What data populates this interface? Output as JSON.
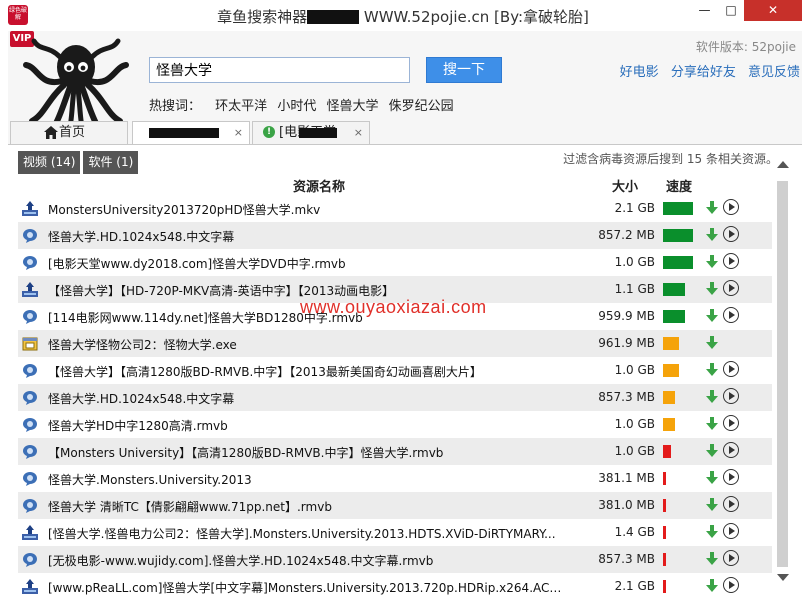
{
  "window": {
    "title_prefix": "章鱼搜索神器",
    "title_suffix": " WWW.52pojie.cn [By:拿破轮胎]",
    "icon_text": "绿色破解",
    "minimize": "—",
    "maximize": "□",
    "close": "✕"
  },
  "header": {
    "vip": "VIP",
    "search_value": "怪兽大学",
    "search_button": "搜一下",
    "hot_label": "热搜词：",
    "hot_words": [
      "环太平洋",
      "小时代",
      "怪兽大学",
      "侏罗纪公园"
    ],
    "version": "软件版本: 52pojie",
    "links": [
      "好电影",
      "分享给好友",
      "意见反馈"
    ]
  },
  "tabs": [
    {
      "label": "首页"
    },
    {
      "label": "",
      "close": "×"
    },
    {
      "label": "[电影天堂",
      "close": "×"
    }
  ],
  "filters": [
    {
      "label": "视频 (14)"
    },
    {
      "label": "软件 (1)"
    }
  ],
  "summary": "过滤含病毒资源后搜到 15 条相关资源。",
  "columns": {
    "name": "资源名称",
    "size": "大小",
    "speed": "速度"
  },
  "watermark": "www.ouyaoxiazai.com",
  "colors": {
    "speed_green": "#0a8f2c",
    "speed_orange": "#f5a30a",
    "speed_red": "#e31b1b",
    "link": "#2a6ebb"
  },
  "rows": [
    {
      "type": "bt",
      "name": "MonstersUniversity2013720pHD怪兽大学.mkv",
      "size": "2.1 GB",
      "speed": "green",
      "play": true
    },
    {
      "type": "ed2k",
      "name": "怪兽大学.HD.1024x548.中文字幕",
      "size": "857.2 MB",
      "speed": "green",
      "play": true
    },
    {
      "type": "ed2k",
      "name": "[电影天堂www.dy2018.com]怪兽大学DVD中字.rmvb",
      "size": "1.0 GB",
      "speed": "green",
      "play": true
    },
    {
      "type": "bt",
      "name": "【怪兽大学】【HD-720P-MKV高清-英语中字】【2013动画电影】",
      "size": "1.1 GB",
      "speed": "green-short",
      "play": true
    },
    {
      "type": "ed2k",
      "name": "[114电影网www.114dy.net]怪兽大学BD1280中字.rmvb",
      "size": "959.9 MB",
      "speed": "green-short",
      "play": true
    },
    {
      "type": "exe",
      "name": "怪兽大学怪物公司2：怪物大学.exe",
      "size": "961.9 MB",
      "speed": "orange",
      "play": false
    },
    {
      "type": "ed2k",
      "name": "【怪兽大学】【高清1280版BD-RMVB.中字】【2013最新美国奇幻动画喜剧大片】",
      "size": "1.0 GB",
      "speed": "orange",
      "play": true
    },
    {
      "type": "ed2k",
      "name": "怪兽大学.HD.1024x548.中文字幕",
      "size": "857.3 MB",
      "speed": "orange-small",
      "play": true
    },
    {
      "type": "ed2k",
      "name": "怪兽大学HD中字1280高清.rmvb",
      "size": "1.0 GB",
      "speed": "orange-small",
      "play": true
    },
    {
      "type": "ed2k",
      "name": "【Monsters University】【高清1280版BD-RMVB.中字】怪兽大学.rmvb",
      "size": "1.0 GB",
      "speed": "red",
      "play": true
    },
    {
      "type": "ed2k",
      "name": "怪兽大学.Monsters.University.2013",
      "size": "381.1 MB",
      "speed": "red-thin",
      "play": true
    },
    {
      "type": "ed2k",
      "name": "怪兽大学 清晰TC【倩影翩翩www.71pp.net】.rmvb",
      "size": "381.0 MB",
      "speed": "red-thin",
      "play": true
    },
    {
      "type": "bt",
      "name": "[怪兽大学.怪兽电力公司2：怪兽大学].Monsters.University.2013.HDTS.XViD-DiRTYMARY...",
      "size": "1.4 GB",
      "speed": "red-thin",
      "play": true
    },
    {
      "type": "ed2k",
      "name": "[无极电影-www.wujidy.com].怪兽大学.HD.1024x548.中文字幕.rmvb",
      "size": "857.3 MB",
      "speed": "red-thin",
      "play": true
    },
    {
      "type": "bt",
      "name": "[www.pReaLL.com]怪兽大学[中文字幕]Monsters.University.2013.720p.HDRip.x264.AC3-...",
      "size": "2.1 GB",
      "speed": "red-thin",
      "play": true
    }
  ]
}
